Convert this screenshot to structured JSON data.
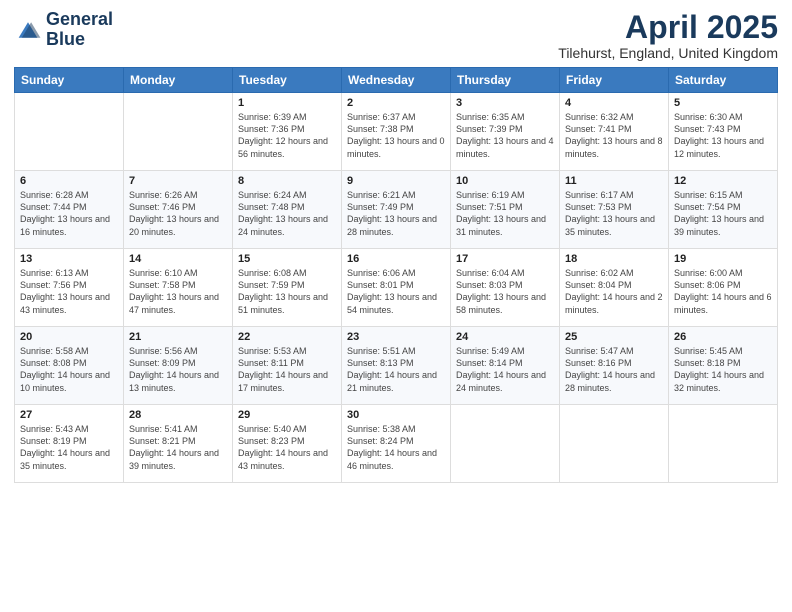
{
  "logo": {
    "line1": "General",
    "line2": "Blue"
  },
  "title": "April 2025",
  "subtitle": "Tilehurst, England, United Kingdom",
  "weekdays": [
    "Sunday",
    "Monday",
    "Tuesday",
    "Wednesday",
    "Thursday",
    "Friday",
    "Saturday"
  ],
  "weeks": [
    [
      {
        "day": null
      },
      {
        "day": null
      },
      {
        "day": "1",
        "sunrise": "Sunrise: 6:39 AM",
        "sunset": "Sunset: 7:36 PM",
        "daylight": "Daylight: 12 hours and 56 minutes."
      },
      {
        "day": "2",
        "sunrise": "Sunrise: 6:37 AM",
        "sunset": "Sunset: 7:38 PM",
        "daylight": "Daylight: 13 hours and 0 minutes."
      },
      {
        "day": "3",
        "sunrise": "Sunrise: 6:35 AM",
        "sunset": "Sunset: 7:39 PM",
        "daylight": "Daylight: 13 hours and 4 minutes."
      },
      {
        "day": "4",
        "sunrise": "Sunrise: 6:32 AM",
        "sunset": "Sunset: 7:41 PM",
        "daylight": "Daylight: 13 hours and 8 minutes."
      },
      {
        "day": "5",
        "sunrise": "Sunrise: 6:30 AM",
        "sunset": "Sunset: 7:43 PM",
        "daylight": "Daylight: 13 hours and 12 minutes."
      }
    ],
    [
      {
        "day": "6",
        "sunrise": "Sunrise: 6:28 AM",
        "sunset": "Sunset: 7:44 PM",
        "daylight": "Daylight: 13 hours and 16 minutes."
      },
      {
        "day": "7",
        "sunrise": "Sunrise: 6:26 AM",
        "sunset": "Sunset: 7:46 PM",
        "daylight": "Daylight: 13 hours and 20 minutes."
      },
      {
        "day": "8",
        "sunrise": "Sunrise: 6:24 AM",
        "sunset": "Sunset: 7:48 PM",
        "daylight": "Daylight: 13 hours and 24 minutes."
      },
      {
        "day": "9",
        "sunrise": "Sunrise: 6:21 AM",
        "sunset": "Sunset: 7:49 PM",
        "daylight": "Daylight: 13 hours and 28 minutes."
      },
      {
        "day": "10",
        "sunrise": "Sunrise: 6:19 AM",
        "sunset": "Sunset: 7:51 PM",
        "daylight": "Daylight: 13 hours and 31 minutes."
      },
      {
        "day": "11",
        "sunrise": "Sunrise: 6:17 AM",
        "sunset": "Sunset: 7:53 PM",
        "daylight": "Daylight: 13 hours and 35 minutes."
      },
      {
        "day": "12",
        "sunrise": "Sunrise: 6:15 AM",
        "sunset": "Sunset: 7:54 PM",
        "daylight": "Daylight: 13 hours and 39 minutes."
      }
    ],
    [
      {
        "day": "13",
        "sunrise": "Sunrise: 6:13 AM",
        "sunset": "Sunset: 7:56 PM",
        "daylight": "Daylight: 13 hours and 43 minutes."
      },
      {
        "day": "14",
        "sunrise": "Sunrise: 6:10 AM",
        "sunset": "Sunset: 7:58 PM",
        "daylight": "Daylight: 13 hours and 47 minutes."
      },
      {
        "day": "15",
        "sunrise": "Sunrise: 6:08 AM",
        "sunset": "Sunset: 7:59 PM",
        "daylight": "Daylight: 13 hours and 51 minutes."
      },
      {
        "day": "16",
        "sunrise": "Sunrise: 6:06 AM",
        "sunset": "Sunset: 8:01 PM",
        "daylight": "Daylight: 13 hours and 54 minutes."
      },
      {
        "day": "17",
        "sunrise": "Sunrise: 6:04 AM",
        "sunset": "Sunset: 8:03 PM",
        "daylight": "Daylight: 13 hours and 58 minutes."
      },
      {
        "day": "18",
        "sunrise": "Sunrise: 6:02 AM",
        "sunset": "Sunset: 8:04 PM",
        "daylight": "Daylight: 14 hours and 2 minutes."
      },
      {
        "day": "19",
        "sunrise": "Sunrise: 6:00 AM",
        "sunset": "Sunset: 8:06 PM",
        "daylight": "Daylight: 14 hours and 6 minutes."
      }
    ],
    [
      {
        "day": "20",
        "sunrise": "Sunrise: 5:58 AM",
        "sunset": "Sunset: 8:08 PM",
        "daylight": "Daylight: 14 hours and 10 minutes."
      },
      {
        "day": "21",
        "sunrise": "Sunrise: 5:56 AM",
        "sunset": "Sunset: 8:09 PM",
        "daylight": "Daylight: 14 hours and 13 minutes."
      },
      {
        "day": "22",
        "sunrise": "Sunrise: 5:53 AM",
        "sunset": "Sunset: 8:11 PM",
        "daylight": "Daylight: 14 hours and 17 minutes."
      },
      {
        "day": "23",
        "sunrise": "Sunrise: 5:51 AM",
        "sunset": "Sunset: 8:13 PM",
        "daylight": "Daylight: 14 hours and 21 minutes."
      },
      {
        "day": "24",
        "sunrise": "Sunrise: 5:49 AM",
        "sunset": "Sunset: 8:14 PM",
        "daylight": "Daylight: 14 hours and 24 minutes."
      },
      {
        "day": "25",
        "sunrise": "Sunrise: 5:47 AM",
        "sunset": "Sunset: 8:16 PM",
        "daylight": "Daylight: 14 hours and 28 minutes."
      },
      {
        "day": "26",
        "sunrise": "Sunrise: 5:45 AM",
        "sunset": "Sunset: 8:18 PM",
        "daylight": "Daylight: 14 hours and 32 minutes."
      }
    ],
    [
      {
        "day": "27",
        "sunrise": "Sunrise: 5:43 AM",
        "sunset": "Sunset: 8:19 PM",
        "daylight": "Daylight: 14 hours and 35 minutes."
      },
      {
        "day": "28",
        "sunrise": "Sunrise: 5:41 AM",
        "sunset": "Sunset: 8:21 PM",
        "daylight": "Daylight: 14 hours and 39 minutes."
      },
      {
        "day": "29",
        "sunrise": "Sunrise: 5:40 AM",
        "sunset": "Sunset: 8:23 PM",
        "daylight": "Daylight: 14 hours and 43 minutes."
      },
      {
        "day": "30",
        "sunrise": "Sunrise: 5:38 AM",
        "sunset": "Sunset: 8:24 PM",
        "daylight": "Daylight: 14 hours and 46 minutes."
      },
      {
        "day": null
      },
      {
        "day": null
      },
      {
        "day": null
      }
    ]
  ]
}
